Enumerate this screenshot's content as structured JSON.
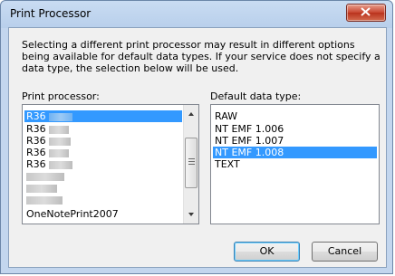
{
  "window": {
    "title": "Print Processor"
  },
  "description": "Selecting a different print processor may result in different options being available for default data types. If your service does not specify a data type, the selection below will be used.",
  "print_processor": {
    "label": "Print processor:",
    "items": [
      {
        "label": "R36",
        "selected": true
      },
      {
        "label": "R36",
        "selected": false
      },
      {
        "label": "R36",
        "selected": false
      },
      {
        "label": "R36",
        "selected": false
      },
      {
        "label": "R36",
        "selected": false
      },
      {
        "label": "",
        "selected": false
      },
      {
        "label": "",
        "selected": false
      },
      {
        "label": "",
        "selected": false
      },
      {
        "label": "OneNotePrint2007",
        "selected": false
      }
    ]
  },
  "data_type": {
    "label": "Default data type:",
    "items": [
      {
        "label": "RAW",
        "selected": false
      },
      {
        "label": "NT EMF 1.006",
        "selected": false
      },
      {
        "label": "NT EMF 1.007",
        "selected": false
      },
      {
        "label": "NT EMF 1.008",
        "selected": true
      },
      {
        "label": "TEXT",
        "selected": false
      }
    ]
  },
  "buttons": {
    "ok": "OK",
    "cancel": "Cancel"
  },
  "icons": {
    "close": "close-icon",
    "scroll_up": "scroll-up-arrow-icon",
    "scroll_down": "scroll-down-arrow-icon"
  }
}
